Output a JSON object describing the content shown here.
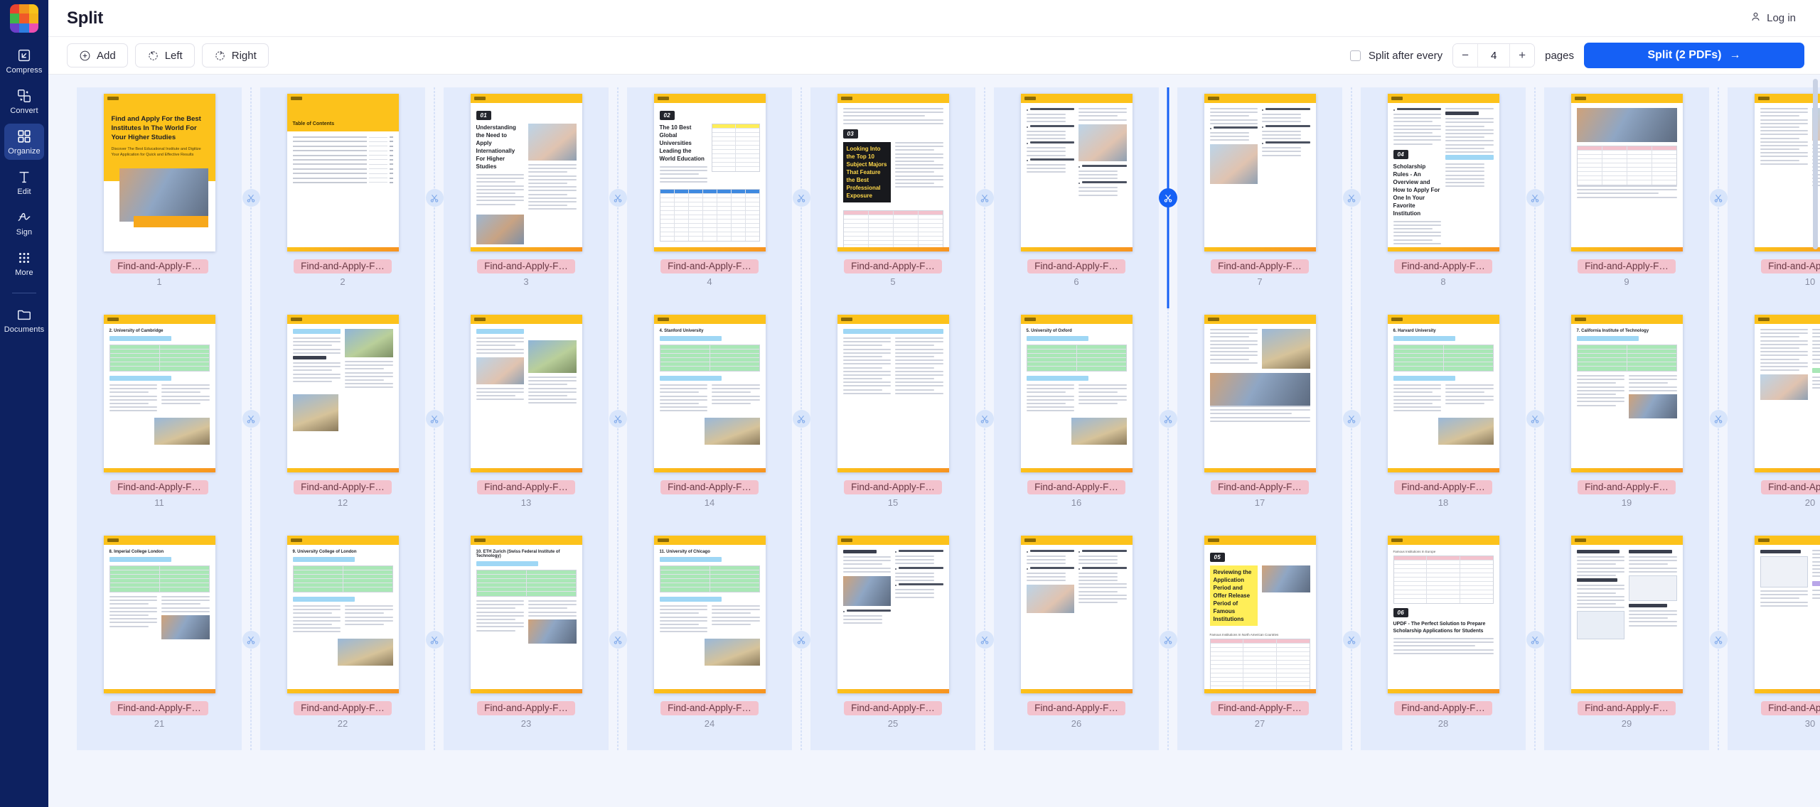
{
  "app": {
    "title": "Split",
    "accent_blue": "#1560f5",
    "sidebar_bg": "#0d2160",
    "canvas_bg": "#f2f5fd",
    "selection_bg": "#e3ebfc",
    "name_badge_bg": "#f3c2cd"
  },
  "sidebar": {
    "items": [
      {
        "label": "Compress",
        "icon": "compress-icon",
        "active": false
      },
      {
        "label": "Convert",
        "icon": "convert-icon",
        "active": false
      },
      {
        "label": "Organize",
        "icon": "organize-icon",
        "active": true
      },
      {
        "label": "Edit",
        "icon": "edit-icon",
        "active": false
      },
      {
        "label": "Sign",
        "icon": "sign-icon",
        "active": false
      },
      {
        "label": "More",
        "icon": "more-grid-icon",
        "active": false
      },
      {
        "label": "Documents",
        "icon": "documents-folder-icon",
        "active": false
      }
    ]
  },
  "header": {
    "title": "Split",
    "login_label": "Log in"
  },
  "toolbar": {
    "add_label": "Add",
    "rotate_left_label": "Left",
    "rotate_right_label": "Right",
    "split_every_label": "Split after every",
    "split_every_checked": false,
    "minus_label": "−",
    "step_value": "4",
    "plus_label": "+",
    "pages_label": "pages",
    "split_button_label": "Split (2 PDFs)",
    "split_button_arrow": "→"
  },
  "document": {
    "file_label": "Find-and-Apply-F…",
    "total_pages_shown": 30,
    "split_points_active": [
      6
    ],
    "pages": [
      {
        "number": "1",
        "label": "Find-and-Apply-F…",
        "selected": true,
        "kind": "cover",
        "section": "",
        "heading": "Find and Apply For the Best Institutes In The World For Your Higher Studies",
        "subheading": "Discover The Best Educational Institute and Digitize Your Application for Quick and Effective Results"
      },
      {
        "number": "2",
        "label": "Find-and-Apply-F…",
        "selected": true,
        "kind": "toc",
        "section": "",
        "heading": "Table of Contents",
        "subheading": ""
      },
      {
        "number": "3",
        "label": "Find-and-Apply-F…",
        "selected": true,
        "kind": "chapter",
        "section": "01",
        "heading": "Understanding the Need to Apply Internationally For Higher Studies",
        "subheading": ""
      },
      {
        "number": "4",
        "label": "Find-and-Apply-F…",
        "selected": true,
        "kind": "chapter-table",
        "section": "02",
        "heading": "The 10 Best Global Universities Leading the World Education",
        "subheading": ""
      },
      {
        "number": "5",
        "label": "Find-and-Apply-F…",
        "selected": true,
        "kind": "chapter-dark",
        "section": "03",
        "heading": "Looking Into the Top 10 Subject Majors That Feature the Best Professional Exposure",
        "subheading": ""
      },
      {
        "number": "6",
        "label": "Find-and-Apply-F…",
        "selected": true,
        "kind": "bullets-photo",
        "section": "",
        "heading": "Health and Medical Research",
        "subheading": "Petroleum Engineering / Zoology / Pharmacology & Toxicology / Economics"
      },
      {
        "number": "7",
        "label": "Find-and-Apply-F…",
        "selected": true,
        "kind": "bullets-photo2",
        "section": "",
        "heading": "Applied Mathematics",
        "subheading": "Astronomy / Engineering and Materials / Engineering Physics"
      },
      {
        "number": "8",
        "label": "Find-and-Apply-F…",
        "selected": true,
        "kind": "chapter-two-col",
        "section": "04",
        "heading": "Scholarship Rules - An Overview and How to Apply For One In Your Favorite Institution",
        "subheading": "Naval Architecture and Marine Engineering"
      },
      {
        "number": "9",
        "label": "Find-and-Apply-F…",
        "selected": true,
        "kind": "table-photo",
        "section": "",
        "heading": "",
        "subheading": ""
      },
      {
        "number": "10",
        "label": "Find-and-Apply-F…",
        "selected": true,
        "kind": "text-photo",
        "section": "",
        "heading": "",
        "subheading": ""
      },
      {
        "number": "11",
        "label": "Find-and-Apply-F…",
        "selected": true,
        "kind": "uni-green",
        "section": "",
        "heading": "2. University of Cambridge",
        "subheading": ""
      },
      {
        "number": "12",
        "label": "Find-and-Apply-F…",
        "selected": true,
        "kind": "chip-photos",
        "section": "",
        "heading": "Intro Brief",
        "subheading": ""
      },
      {
        "number": "13",
        "label": "Find-and-Apply-F…",
        "selected": true,
        "kind": "chip-photos2",
        "section": "",
        "heading": "Heritage",
        "subheading": ""
      },
      {
        "number": "14",
        "label": "Find-and-Apply-F…",
        "selected": true,
        "kind": "uni-green2",
        "section": "",
        "heading": "4. Stanford University",
        "subheading": ""
      },
      {
        "number": "15",
        "label": "Find-and-Apply-F…",
        "selected": true,
        "kind": "chip-text",
        "section": "",
        "heading": "",
        "subheading": ""
      },
      {
        "number": "16",
        "label": "Find-and-Apply-F…",
        "selected": true,
        "kind": "uni-green3",
        "section": "",
        "heading": "5. University of Oxford",
        "subheading": ""
      },
      {
        "number": "17",
        "label": "Find-and-Apply-F…",
        "selected": true,
        "kind": "two-photo",
        "section": "",
        "heading": "",
        "subheading": ""
      },
      {
        "number": "18",
        "label": "Find-and-Apply-F…",
        "selected": true,
        "kind": "uni-green4",
        "section": "",
        "heading": "6. Harvard University",
        "subheading": ""
      },
      {
        "number": "19",
        "label": "Find-and-Apply-F…",
        "selected": true,
        "kind": "uni-photo",
        "section": "",
        "heading": "7. California Institute of Technology",
        "subheading": ""
      },
      {
        "number": "20",
        "label": "Find-and-Apply-F…",
        "selected": true,
        "kind": "text-photo2",
        "section": "",
        "heading": "",
        "subheading": ""
      },
      {
        "number": "21",
        "label": "Find-and-Apply-F…",
        "selected": true,
        "kind": "uni-imperial",
        "section": "",
        "heading": "8. Imperial College London",
        "subheading": ""
      },
      {
        "number": "22",
        "label": "Find-and-Apply-F…",
        "selected": true,
        "kind": "uni-green5",
        "section": "",
        "heading": "9. University College of London",
        "subheading": ""
      },
      {
        "number": "23",
        "label": "Find-and-Apply-F…",
        "selected": true,
        "kind": "uni-eth",
        "section": "",
        "heading": "10. ETH Zurich (Swiss Federal Institute of Technology)",
        "subheading": ""
      },
      {
        "number": "24",
        "label": "Find-and-Apply-F…",
        "selected": true,
        "kind": "uni-green6",
        "section": "",
        "heading": "11. University of Chicago",
        "subheading": ""
      },
      {
        "number": "25",
        "label": "Find-and-Apply-F…",
        "selected": true,
        "kind": "practical-photo",
        "section": "",
        "heading": "Practical Tips to Help You In Scholarships",
        "subheading": "Start Preparations / Fine Your Tuning / Work on Your Application Details"
      },
      {
        "number": "26",
        "label": "Find-and-Apply-F…",
        "selected": true,
        "kind": "photo-bullets",
        "section": "",
        "heading": "Add Distinctiveness",
        "subheading": "Prepare Personal Cover Letter Well / Be Punctual Oriented"
      },
      {
        "number": "27",
        "label": "Find-and-Apply-F…",
        "selected": true,
        "kind": "chapter-yellow",
        "section": "05",
        "heading": "Reviewing the Application Period and Offer Release Period of Famous Institutions",
        "subheading": "Famous Institutions In North American Countries"
      },
      {
        "number": "28",
        "label": "Find-and-Apply-F…",
        "selected": true,
        "kind": "chapter-updf",
        "section": "06",
        "heading": "UPDF - The Perfect Solution to Prepare Scholarship Applications for Students",
        "subheading": "Famous Institutions In Europe"
      },
      {
        "number": "29",
        "label": "Find-and-Apply-F…",
        "selected": true,
        "kind": "steps",
        "section": "",
        "heading": "1. Editing Your Document",
        "subheading": "2. Annotating Applications / 3. Organizing Your Application / 4. Signing the Application"
      },
      {
        "number": "30",
        "label": "Find-and-Apply-F…",
        "selected": true,
        "kind": "converting",
        "section": "",
        "heading": "5. Converting Applications",
        "subheading": ""
      }
    ]
  }
}
